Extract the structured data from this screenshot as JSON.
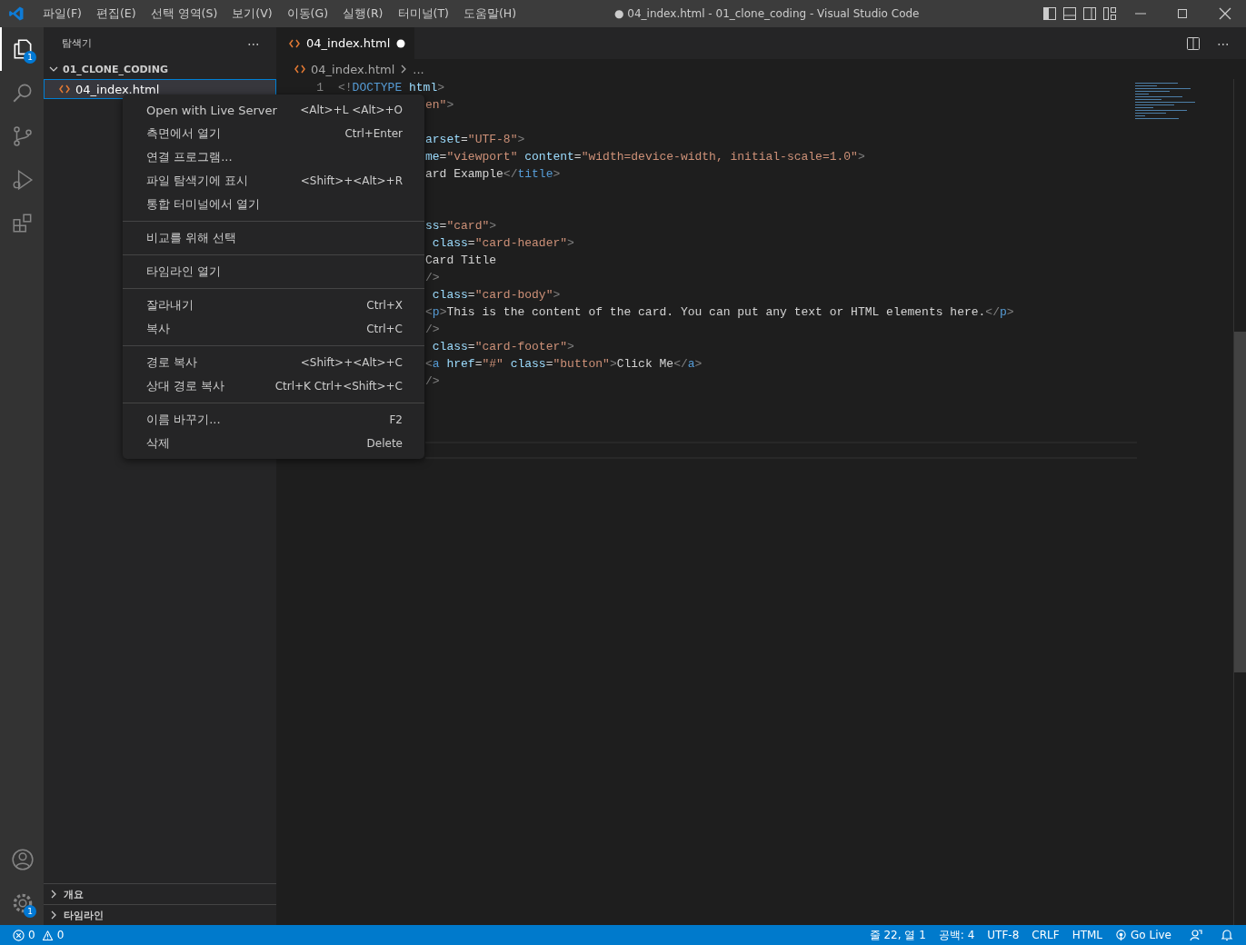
{
  "window": {
    "title": "● 04_index.html - 01_clone_coding - Visual Studio Code"
  },
  "menu_bar": [
    "파일(F)",
    "편집(E)",
    "선택 영역(S)",
    "보기(V)",
    "이동(G)",
    "실행(R)",
    "터미널(T)",
    "도움말(H)"
  ],
  "activity_bar": {
    "top": [
      {
        "kind": "explorer",
        "selected": true,
        "badge": "1"
      },
      {
        "kind": "search",
        "selected": false
      },
      {
        "kind": "source-control",
        "selected": false
      },
      {
        "kind": "run",
        "selected": false
      },
      {
        "kind": "extensions",
        "selected": false
      }
    ],
    "bottom": [
      {
        "kind": "account"
      },
      {
        "kind": "settings",
        "badge": "1"
      }
    ]
  },
  "sidebar": {
    "title": "탐색기",
    "more": "⋯",
    "folder": {
      "name": "01_CLONE_CODING",
      "expanded": true,
      "children": [
        {
          "name": "04_index.html",
          "selected": true
        }
      ]
    },
    "sections": [
      {
        "name": "개요",
        "expanded": false
      },
      {
        "name": "타임라인",
        "expanded": false
      }
    ]
  },
  "tabs": [
    {
      "label": "04_index.html",
      "selected": true,
      "dirty": true
    }
  ],
  "editor_actions": {
    "more": "⋯"
  },
  "breadcrumb": [
    "04_index.html",
    "..."
  ],
  "code": [
    {
      "kind": "full",
      "number": "1",
      "segments": [
        {
          "kind": "punct",
          "t": "<!"
        },
        {
          "kind": "tag",
          "t": "DOCTYPE"
        },
        {
          "kind": "attr",
          "t": " html"
        },
        {
          "kind": "punct",
          "t": ">"
        }
      ]
    },
    {
      "kind": "clipped",
      "segments": [
        {
          "kind": "str",
          "t": "en\""
        },
        {
          "kind": "punct",
          "t": ">"
        }
      ]
    },
    {
      "kind": "clipped"
    },
    {
      "kind": "clipped",
      "segments": [
        {
          "kind": "attr",
          "t": "arset"
        },
        {
          "kind": "text",
          "t": "="
        },
        {
          "kind": "str",
          "t": "\"UTF-8\""
        },
        {
          "kind": "punct",
          "t": ">"
        }
      ]
    },
    {
      "kind": "clipped",
      "segments": [
        {
          "kind": "attr",
          "t": "me"
        },
        {
          "kind": "text",
          "t": "="
        },
        {
          "kind": "str",
          "t": "\"viewport\""
        },
        {
          "kind": "attr",
          "t": " content"
        },
        {
          "kind": "text",
          "t": "="
        },
        {
          "kind": "str",
          "t": "\"width=device-width, initial-scale=1.0\""
        },
        {
          "kind": "punct",
          "t": ">"
        }
      ]
    },
    {
      "kind": "clipped",
      "segments": [
        {
          "kind": "text",
          "t": "ard Example"
        },
        {
          "kind": "punct",
          "t": "</"
        },
        {
          "kind": "tag",
          "t": "title"
        },
        {
          "kind": "punct",
          "t": ">"
        }
      ]
    },
    {
      "kind": "clipped"
    },
    {
      "kind": "clipped"
    },
    {
      "kind": "clipped",
      "segments": [
        {
          "kind": "attr",
          "t": "ss"
        },
        {
          "kind": "text",
          "t": "="
        },
        {
          "kind": "str",
          "t": "\"card\""
        },
        {
          "kind": "punct",
          "t": ">"
        }
      ]
    },
    {
      "kind": "clipped",
      "segments": [
        {
          "kind": "attr",
          "t": " class"
        },
        {
          "kind": "text",
          "t": "="
        },
        {
          "kind": "str",
          "t": "\"card-header\""
        },
        {
          "kind": "punct",
          "t": ">"
        }
      ]
    },
    {
      "kind": "clipped",
      "segments": [
        {
          "kind": "text",
          "t": "Card Title"
        }
      ]
    },
    {
      "kind": "clipped",
      "segments": [
        {
          "kind": "punct",
          "t": "/>"
        }
      ]
    },
    {
      "kind": "clipped",
      "segments": [
        {
          "kind": "attr",
          "t": " class"
        },
        {
          "kind": "text",
          "t": "="
        },
        {
          "kind": "str",
          "t": "\"card-body\""
        },
        {
          "kind": "punct",
          "t": ">"
        }
      ]
    },
    {
      "kind": "clipped",
      "segments": [
        {
          "kind": "punct",
          "t": "<"
        },
        {
          "kind": "tag",
          "t": "p"
        },
        {
          "kind": "punct",
          "t": ">"
        },
        {
          "kind": "text",
          "t": "This is the content of the card. You can put any text or HTML elements here."
        },
        {
          "kind": "punct",
          "t": "</"
        },
        {
          "kind": "tag",
          "t": "p"
        },
        {
          "kind": "punct",
          "t": ">"
        }
      ]
    },
    {
      "kind": "clipped",
      "segments": [
        {
          "kind": "punct",
          "t": "/>"
        }
      ]
    },
    {
      "kind": "clipped",
      "segments": [
        {
          "kind": "attr",
          "t": " class"
        },
        {
          "kind": "text",
          "t": "="
        },
        {
          "kind": "str",
          "t": "\"card-footer\""
        },
        {
          "kind": "punct",
          "t": ">"
        }
      ]
    },
    {
      "kind": "clipped",
      "segments": [
        {
          "kind": "punct",
          "t": "<"
        },
        {
          "kind": "tag",
          "t": "a"
        },
        {
          "kind": "attr",
          "t": " href"
        },
        {
          "kind": "text",
          "t": "="
        },
        {
          "kind": "str",
          "t": "\"#\""
        },
        {
          "kind": "attr",
          "t": " class"
        },
        {
          "kind": "text",
          "t": "="
        },
        {
          "kind": "str",
          "t": "\"button\""
        },
        {
          "kind": "punct",
          "t": ">"
        },
        {
          "kind": "text",
          "t": "Click Me"
        },
        {
          "kind": "punct",
          "t": "</"
        },
        {
          "kind": "tag",
          "t": "a"
        },
        {
          "kind": "punct",
          "t": ">"
        }
      ]
    },
    {
      "kind": "clipped",
      "segments": [
        {
          "kind": "punct",
          "t": "/>"
        }
      ]
    },
    {
      "kind": "clipped"
    },
    {
      "kind": "clipped"
    },
    {
      "kind": "clipped"
    },
    {
      "kind": "current"
    }
  ],
  "context_menu": {
    "groups": [
      [
        {
          "label": "Open with Live Server",
          "shortcut": "<Alt>+L <Alt>+O"
        },
        {
          "label": "측면에서 열기",
          "shortcut": "Ctrl+Enter"
        },
        {
          "label": "연결 프로그램..."
        },
        {
          "label": "파일 탐색기에 표시",
          "shortcut": "<Shift>+<Alt>+R"
        },
        {
          "label": "통합 터미널에서 열기"
        }
      ],
      [
        {
          "label": "비교를 위해 선택"
        }
      ],
      [
        {
          "label": "타임라인 열기"
        }
      ],
      [
        {
          "label": "잘라내기",
          "shortcut": "Ctrl+X"
        },
        {
          "label": "복사",
          "shortcut": "Ctrl+C"
        }
      ],
      [
        {
          "label": "경로 복사",
          "shortcut": "<Shift>+<Alt>+C"
        },
        {
          "label": "상대 경로 복사",
          "shortcut": "Ctrl+K Ctrl+<Shift>+C"
        }
      ],
      [
        {
          "label": "이름 바꾸기...",
          "shortcut": "F2"
        },
        {
          "label": "삭제",
          "shortcut": "Delete"
        }
      ]
    ]
  },
  "status_bar": {
    "errors": "0",
    "warnings": "0",
    "right": [
      {
        "kind": "text",
        "label": "줄 22, 열 1"
      },
      {
        "kind": "text",
        "label": "공백: 4"
      },
      {
        "kind": "text",
        "label": "UTF-8"
      },
      {
        "kind": "text",
        "label": "CRLF"
      },
      {
        "kind": "text",
        "label": "HTML"
      },
      {
        "kind": "live",
        "label": "Go Live"
      },
      {
        "kind": "feedback"
      },
      {
        "kind": "bell"
      }
    ]
  }
}
